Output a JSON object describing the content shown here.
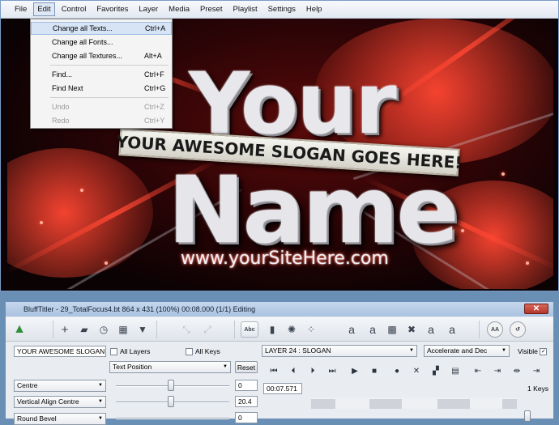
{
  "menubar": {
    "items": [
      "File",
      "Edit",
      "Control",
      "Favorites",
      "Layer",
      "Media",
      "Preset",
      "Playlist",
      "Settings",
      "Help"
    ],
    "active": "Edit"
  },
  "edit_menu": {
    "items": [
      {
        "label": "Change all Texts...",
        "shortcut": "Ctrl+A",
        "highlighted": true,
        "disabled": false
      },
      {
        "label": "Change all Fonts...",
        "shortcut": "",
        "highlighted": false,
        "disabled": false
      },
      {
        "label": "Change all Textures...",
        "shortcut": "Alt+A",
        "highlighted": false,
        "disabled": false
      },
      {
        "label": "Find...",
        "shortcut": "Ctrl+F",
        "highlighted": false,
        "disabled": false
      },
      {
        "label": "Find Next",
        "shortcut": "Ctrl+G",
        "highlighted": false,
        "disabled": false
      },
      {
        "label": "Undo",
        "shortcut": "Ctrl+Z",
        "highlighted": false,
        "disabled": true
      },
      {
        "label": "Redo",
        "shortcut": "Ctrl+Y",
        "highlighted": false,
        "disabled": true
      }
    ]
  },
  "preview": {
    "title_line1": "Your",
    "title_line2": "Name",
    "slogan": "YOUR AWESOME SLOGAN GOES HERE!",
    "site": "www.yourSiteHere.com"
  },
  "window": {
    "title": "BluffTitler - 29_TotalFocus4.bt 864 x 431 (100%) 00:08.000 (1/1) Editing",
    "close": "✕"
  },
  "panel": {
    "text_value": "YOUR AWESOME SLOGAN G",
    "all_layers": "All Layers",
    "all_keys": "All Keys",
    "property_select": "Text Position",
    "reset": "Reset",
    "layer_select": "LAYER      24        : SLOGAN",
    "easing_select": "Accelerate and Dec",
    "visible": "Visible",
    "align_select": "Centre",
    "valign_select": "Vertical Align Centre",
    "bevel_select": "Round Bevel",
    "value1": "0",
    "value2": "20.4",
    "value3": "0",
    "time": "00:07.571",
    "keys": "1 Keys"
  },
  "colors": {
    "menubar_bg": "#eef2f8",
    "preview_red": "#c81010",
    "titlebar": "#b8cde8",
    "close_red": "#c24a3e"
  }
}
